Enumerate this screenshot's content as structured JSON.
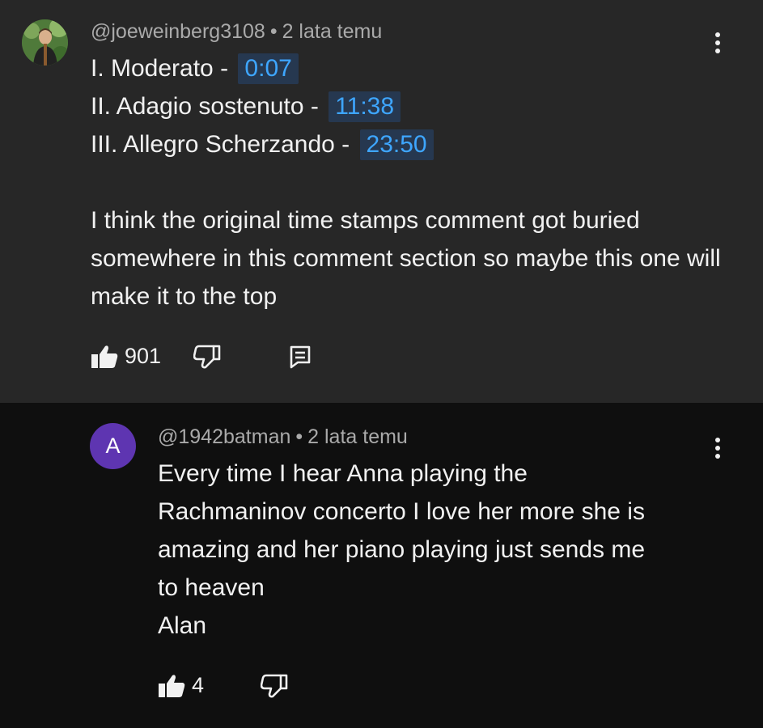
{
  "comments": [
    {
      "author": "@joeweinberg3108",
      "time": "2 lata temu",
      "avatar_icon": "user-photo-avatar",
      "chapters": [
        {
          "title": "I. Moderato -",
          "timestamp": "0:07"
        },
        {
          "title": "II. Adagio sostenuto -",
          "timestamp": "11:38"
        },
        {
          "title": "III. Allegro Scherzando -",
          "timestamp": "23:50"
        }
      ],
      "text": "I think the original time stamps comment got buried somewhere in this comment section so maybe this one will make it to the top",
      "likes": "901"
    },
    {
      "author": "@1942batman",
      "time": "2 lata temu",
      "avatar_letter": "A",
      "avatar_color": "#5e35b1",
      "text_lines": [
        "Every time I hear Anna playing the",
        "Rachmaninov concerto I love her more she is",
        "amazing and her piano playing just sends me",
        "to heaven",
        "Alan"
      ],
      "likes": "4"
    }
  ],
  "colors": {
    "top_bg": "#272727",
    "reply_bg": "#0f0f0f",
    "timestamp_link": "#3ea6ff",
    "meta_text": "#aaaaaa"
  },
  "separator": "•"
}
